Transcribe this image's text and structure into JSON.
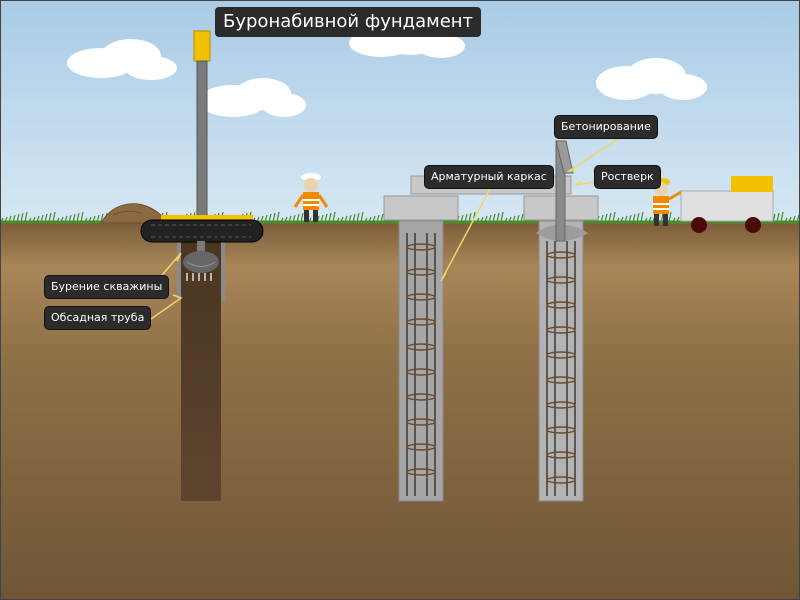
{
  "title": "Буронабивной фундамент",
  "labels": {
    "drilling": "Бурение скважины",
    "casing": "Обсадная труба",
    "rebar_cage": "Арматурный каркас",
    "concreting": "Бетонирование",
    "grillage": "Ростверк"
  },
  "colors": {
    "sky": "#bfd8ec",
    "soil": "#8f7147",
    "label_bg": "#2b2b2b",
    "leader_line": "#f2d56a",
    "rig_yellow": "#f2c200",
    "concrete": "#b3b3b3"
  },
  "icons": [
    "cloud-icon",
    "drilling-rig-icon",
    "worker-icon",
    "concrete-truck-icon",
    "soil-pile-icon"
  ]
}
